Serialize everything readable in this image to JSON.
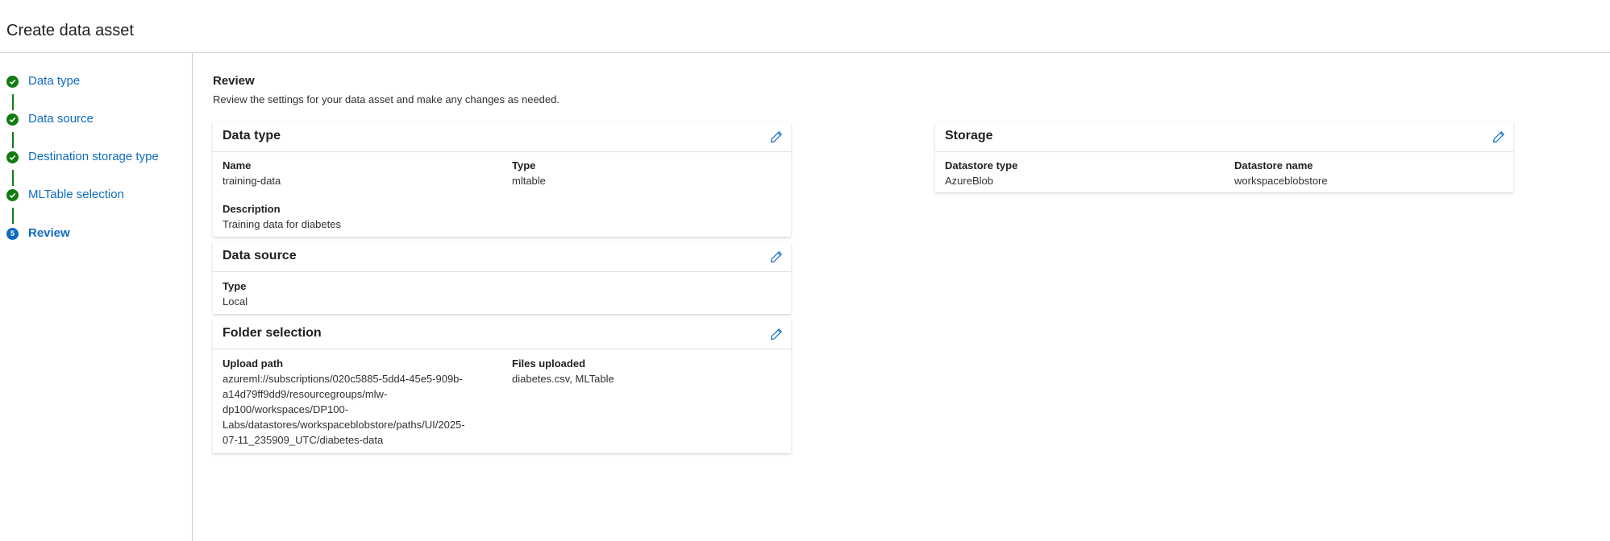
{
  "header": {
    "title": "Create data asset"
  },
  "steps": [
    {
      "label": "Data type",
      "status": "done"
    },
    {
      "label": "Data source",
      "status": "done"
    },
    {
      "label": "Destination storage type",
      "status": "done"
    },
    {
      "label": "MLTable selection",
      "status": "done"
    },
    {
      "label": "Review",
      "status": "current",
      "number": "5"
    }
  ],
  "review": {
    "title": "Review",
    "description": "Review the settings for your data asset and make any changes as needed."
  },
  "cards": {
    "data_type": {
      "title": "Data type",
      "name_label": "Name",
      "name_value": "training-data",
      "type_label": "Type",
      "type_value": "mltable",
      "desc_label": "Description",
      "desc_value": "Training data for diabetes"
    },
    "data_source": {
      "title": "Data source",
      "type_label": "Type",
      "type_value": "Local"
    },
    "folder_selection": {
      "title": "Folder selection",
      "path_label": "Upload path",
      "path_lines": [
        "azureml://subscriptions/020c5885-5dd4-45e5-909b-",
        "a14d79ff9dd9/resourcegroups/mlw-",
        "dp100/workspaces/DP100-",
        "Labs/datastores/workspaceblobstore/paths/UI/2025-",
        "07-11_235909_UTC/diabetes-data"
      ],
      "files_label": "Files uploaded",
      "files_value": "diabetes.csv, MLTable"
    },
    "storage": {
      "title": "Storage",
      "ds_type_label": "Datastore type",
      "ds_type_value": "AzureBlob",
      "ds_name_label": "Datastore name",
      "ds_name_value": "workspaceblobstore"
    }
  },
  "colors": {
    "accent": "#0f6cbd",
    "success": "#107c10",
    "border": "#d2d0ce"
  },
  "icons": {
    "done": "checkmark-circle-icon",
    "edit": "pencil-icon"
  }
}
